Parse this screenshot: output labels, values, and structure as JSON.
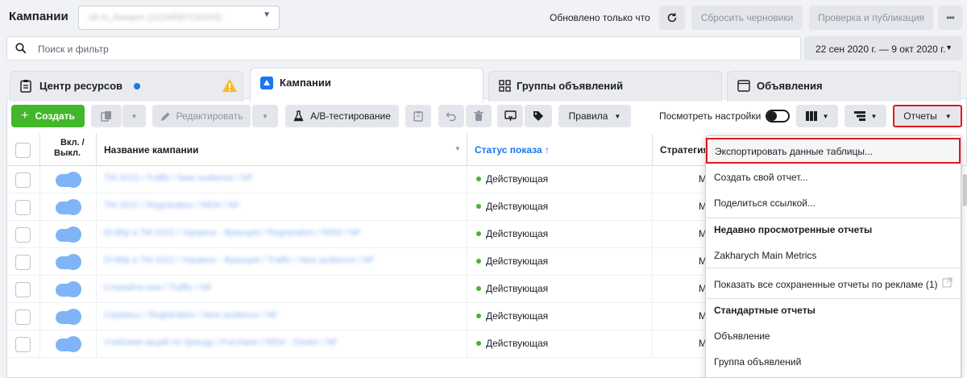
{
  "topbar": {
    "title": "Кампании",
    "account_blurred": "ult m_Аккаунт (11234567132043)",
    "updated": "Обновлено только что",
    "discard_label": "Сбросить черновики",
    "publish_label": "Проверка и публикация"
  },
  "search": {
    "placeholder": "Поиск и фильтр"
  },
  "daterange": {
    "label": "22 сен 2020 г. — 9 окт 2020 г."
  },
  "tabs": [
    {
      "label": "Центр ресурсов"
    },
    {
      "label": "Кампании"
    },
    {
      "label": "Группы объявлений"
    },
    {
      "label": "Объявления"
    }
  ],
  "toolbar": {
    "create_label": "Создать",
    "edit_label": "Редактировать",
    "ab_label": "A/B-тестирование",
    "rules_label": "Правила",
    "view_settings_label": "Посмотреть настройки",
    "reports_label": "Отчеты"
  },
  "table": {
    "headers": {
      "onoff_line1": "Вкл. /",
      "onoff_line2": "Выкл.",
      "name": "Название кампании",
      "status": "Статус показа ↑",
      "strategy": "Стратегия"
    },
    "rows": [
      {
        "name": "TM 2022 / Traffic / New audience / NF",
        "status": "Действующая",
        "strategy": "M"
      },
      {
        "name": "TM 2022 / Registration / REM / NF",
        "status": "Действующая",
        "strategy": "M"
      },
      {
        "name": "Di-Blip в TM 2022 / Украина - Франция / Registration / REM / NF",
        "status": "Действующая",
        "strategy": "M"
      },
      {
        "name": "Di-Blip в TM 2022 / Украина - Франция / Traffic / New audience / NF",
        "status": "Действующая",
        "strategy": "M"
      },
      {
        "name": "Сливайте.ком / Traffic / NF",
        "status": "Действующая",
        "strategy": "M"
      },
      {
        "name": "Сервисы / Registration / New audience / NF",
        "status": "Действующая",
        "strategy": "M"
      },
      {
        "name": "Учебники акций по бренду / Purchase / REM - Dinam / NF",
        "status": "Действующая",
        "strategy": "M"
      }
    ]
  },
  "reports_menu": {
    "export": "Экспортировать данные таблицы...",
    "create": "Создать свой отчет...",
    "share": "Поделиться ссылкой...",
    "recent_header": "Недавно просмотренные отчеты",
    "recent_item": "Zakharych Main Metrics",
    "show_all": "Показать все сохраненные отчеты по рекламе (1)",
    "standard_header": "Стандартные отчеты",
    "std_ad": "Объявление",
    "std_adgroup": "Группа объявлений"
  },
  "colors": {
    "accent": "#1877f2",
    "create_green": "#42b72a",
    "highlight_red": "#e0191c",
    "warning": "#f7b928"
  }
}
